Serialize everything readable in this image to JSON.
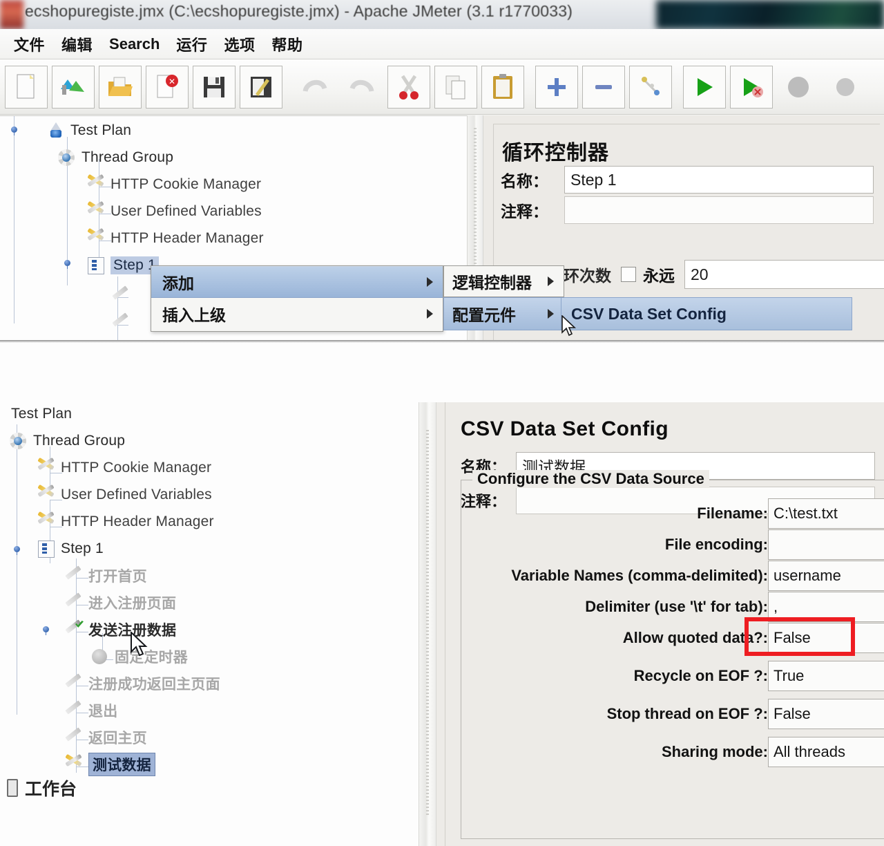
{
  "window": {
    "title": "ecshopuregiste.jmx (C:\\ecshopuregiste.jmx) - Apache JMeter (3.1 r1770033)"
  },
  "menubar": {
    "items": [
      {
        "label": "文件",
        "name": "menu-file"
      },
      {
        "label": "编辑",
        "name": "menu-edit"
      },
      {
        "label": "Search",
        "name": "menu-search"
      },
      {
        "label": "运行",
        "name": "menu-run"
      },
      {
        "label": "选项",
        "name": "menu-options"
      },
      {
        "label": "帮助",
        "name": "menu-help"
      }
    ]
  },
  "toolbar": {
    "buttons": [
      {
        "icon": "new-document-icon",
        "glyph": "🗋"
      },
      {
        "icon": "templates-icon",
        "glyph": "🗂"
      },
      {
        "icon": "open-folder-icon",
        "glyph": "📁"
      },
      {
        "icon": "close-document-icon",
        "glyph": "🗋"
      },
      {
        "icon": "save-icon",
        "glyph": "💾"
      },
      {
        "icon": "save-as-icon",
        "glyph": "💾"
      },
      {
        "icon": "undo-icon",
        "glyph": "↶"
      },
      {
        "icon": "redo-icon",
        "glyph": "↷"
      },
      {
        "icon": "cut-icon",
        "glyph": "✂"
      },
      {
        "icon": "copy-icon",
        "glyph": "🗐"
      },
      {
        "icon": "paste-icon",
        "glyph": "📋"
      },
      {
        "icon": "expand-all-icon",
        "glyph": "✚"
      },
      {
        "icon": "collapse-all-icon",
        "glyph": "▬"
      },
      {
        "icon": "toggle-icon",
        "glyph": "🔧"
      },
      {
        "icon": "start-icon",
        "glyph": "▶"
      },
      {
        "icon": "start-no-pause-icon",
        "glyph": "▶"
      },
      {
        "icon": "stop-icon",
        "glyph": "⬤"
      },
      {
        "icon": "shutdown-icon",
        "glyph": "⬤"
      }
    ]
  },
  "top_view": {
    "tree": [
      {
        "label": "Test Plan",
        "icon": "test-plan-icon",
        "name": "tree-item-test-plan"
      },
      {
        "label": "Thread Group",
        "icon": "thread-group-icon",
        "name": "tree-item-thread-group"
      },
      {
        "label": "HTTP Cookie Manager",
        "icon": "config-wrench-icon",
        "name": "tree-item-http-cookie-manager"
      },
      {
        "label": "User Defined Variables",
        "icon": "config-wrench-icon",
        "name": "tree-item-user-defined-variables"
      },
      {
        "label": "HTTP Header Manager",
        "icon": "config-wrench-icon",
        "name": "tree-item-http-header-manager"
      },
      {
        "label": "Step 1",
        "icon": "loop-controller-icon",
        "name": "tree-item-step-1",
        "selected": true
      }
    ],
    "context_menu": {
      "items": [
        {
          "label": "添加",
          "name": "context-menu-item-add",
          "highlighted": true,
          "has_submenu": true
        },
        {
          "label": "插入上级",
          "name": "context-menu-item-insert-parent",
          "highlighted": false,
          "has_submenu": true
        }
      ],
      "submenu": [
        {
          "label": "逻辑控制器",
          "name": "submenu-item-logic-controller",
          "highlighted": false,
          "has_submenu": true
        },
        {
          "label": "配置元件",
          "name": "submenu-item-config-element",
          "highlighted": true,
          "has_submenu": true
        }
      ],
      "submenu2": [
        {
          "label": "CSV Data Set Config",
          "name": "submenu-item-csv-data-set-config",
          "highlighted": true
        }
      ]
    },
    "panel": {
      "title": "循环控制器",
      "name_label": "名称：",
      "name_value": "Step 1",
      "comment_label": "注释：",
      "comment_value": "",
      "loop_label": "循环次数",
      "forever_label": "永远",
      "loop_count_value": "20"
    }
  },
  "bottom_view": {
    "tree": [
      {
        "label": "Test Plan",
        "icon": "test-plan-icon",
        "name": "tree-item-test-plan",
        "indent": 0,
        "state": "normal"
      },
      {
        "label": "Thread Group",
        "icon": "thread-group-icon",
        "name": "tree-item-thread-group",
        "indent": 1,
        "state": "normal"
      },
      {
        "label": "HTTP Cookie Manager",
        "icon": "config-wrench-icon",
        "name": "tree-item-http-cookie-manager",
        "indent": 2,
        "state": "normal"
      },
      {
        "label": "User Defined Variables",
        "icon": "config-wrench-icon",
        "name": "tree-item-user-defined-variables",
        "indent": 2,
        "state": "normal"
      },
      {
        "label": "HTTP Header Manager",
        "icon": "config-wrench-icon",
        "name": "tree-item-http-header-manager",
        "indent": 2,
        "state": "normal"
      },
      {
        "label": "Step 1",
        "icon": "loop-controller-icon",
        "name": "tree-item-step-1",
        "indent": 2,
        "state": "normal"
      },
      {
        "label": "打开首页",
        "icon": "http-request-icon",
        "name": "tree-item-open-homepage",
        "indent": 3,
        "state": "disabled"
      },
      {
        "label": "进入注册页面",
        "icon": "http-request-icon",
        "name": "tree-item-enter-register-page",
        "indent": 3,
        "state": "disabled"
      },
      {
        "label": "发送注册数据",
        "icon": "http-request-checked-icon",
        "name": "tree-item-send-register-data",
        "indent": 3,
        "state": "active"
      },
      {
        "label": "固定定时器",
        "icon": "timer-icon",
        "name": "tree-item-constant-timer",
        "indent": 4,
        "state": "disabled"
      },
      {
        "label": "注册成功返回主页面",
        "icon": "http-request-icon",
        "name": "tree-item-register-success-return-home",
        "indent": 3,
        "state": "disabled"
      },
      {
        "label": "退出",
        "icon": "http-request-icon",
        "name": "tree-item-logout",
        "indent": 3,
        "state": "disabled"
      },
      {
        "label": "返回主页",
        "icon": "http-request-icon",
        "name": "tree-item-return-home",
        "indent": 3,
        "state": "disabled"
      },
      {
        "label": "测试数据",
        "icon": "config-wrench-icon",
        "name": "tree-item-test-data",
        "indent": 3,
        "state": "selected"
      }
    ],
    "workbench_label": "工作台",
    "panel": {
      "title": "CSV Data Set Config",
      "name_label": "名称：",
      "name_value": "测试数据",
      "comment_label": "注释：",
      "comment_value": "",
      "group_title": "Configure the CSV Data Source",
      "fields": [
        {
          "label": "Filename:",
          "value": "C:\\test.txt",
          "name": "filename-field",
          "highlighted": false
        },
        {
          "label": "File encoding:",
          "value": "",
          "name": "file-encoding-field",
          "highlighted": false
        },
        {
          "label": "Variable Names (comma-delimited):",
          "value": "username",
          "name": "variable-names-field",
          "highlighted": true
        },
        {
          "label": "Delimiter (use '\\t' for tab):",
          "value": ",",
          "name": "delimiter-field",
          "highlighted": false
        },
        {
          "label": "Allow quoted data?:",
          "value": "False",
          "name": "allow-quoted-data-field",
          "highlighted": false
        },
        {
          "label": "Recycle on EOF ?:",
          "value": "True",
          "name": "recycle-on-eof-field",
          "highlighted": false
        },
        {
          "label": "Stop thread on EOF ?:",
          "value": "False",
          "name": "stop-thread-on-eof-field",
          "highlighted": false
        },
        {
          "label": "Sharing mode:",
          "value": "All threads",
          "name": "sharing-mode-field",
          "highlighted": false
        }
      ]
    }
  },
  "colors": {
    "highlight_red": "#ee1d22",
    "menu_highlight": "#a3bbda",
    "selection_blue": "#9fb3d6"
  }
}
